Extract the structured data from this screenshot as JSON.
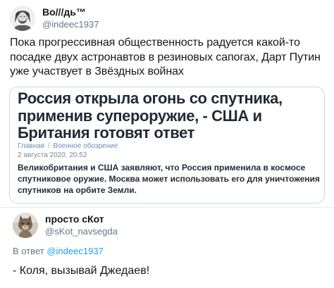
{
  "tweet": {
    "author": {
      "display_name": "Во///дь™",
      "handle": "@indeec1937"
    },
    "text": "Пока прогрессивная общественность радуется какой-то посадке двух астронавтов в резиновых сапогах, Дарт Путин уже участвует в Звёздных войнах"
  },
  "article": {
    "title": "Россия открыла огонь со спутника, применив супероружие, - США и Британия готовят ответ",
    "breadcrumb": [
      "Главная",
      "Военное обозрение"
    ],
    "breadcrumb_separator": "/",
    "date": "2 августа 2020, 20:52",
    "lead": "Великобритания и США заявляют, что Россия применила в космосе спутниковое оружие. Москва может использовать его для уничтожения спутников на орбите Земли."
  },
  "reply": {
    "author": {
      "display_name": "просто сКот",
      "handle": "@sKot_navsegda"
    },
    "context_prefix": "В ответ",
    "context_mention": "@indeec1937",
    "text": "- Коля, вызывай Джедаев!"
  },
  "colors": {
    "text_primary": "#14171a",
    "text_secondary": "#657786",
    "link": "#1da1f2",
    "card_border": "#ccd6dd",
    "article_crumb": "#6a8db8"
  }
}
